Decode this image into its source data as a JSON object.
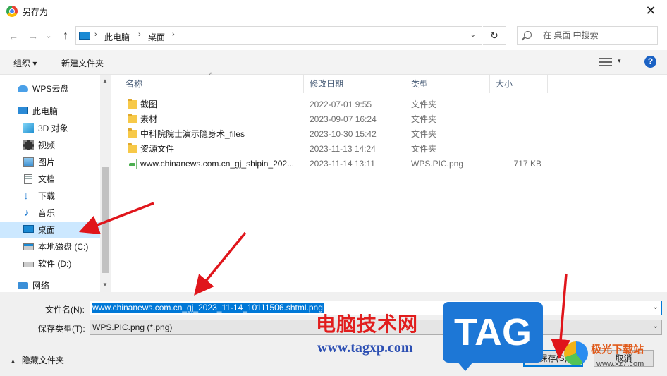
{
  "window": {
    "title": "另存为",
    "close_glyph": "✕"
  },
  "nav": {
    "back": "←",
    "forward": "→",
    "down": "⌄",
    "up": "↑",
    "refresh": "↻",
    "dropdown": "⌄"
  },
  "address": {
    "crumbs": [
      "此电脑",
      "桌面"
    ]
  },
  "search": {
    "placeholder": "在 桌面 中搜索"
  },
  "toolbar": {
    "organize": "组织 ▾",
    "new_folder": "新建文件夹",
    "help": "?",
    "dropdown": "▾"
  },
  "sidebar": {
    "items": [
      {
        "label": "WPS云盘",
        "icon": "cloud-icon"
      },
      {
        "label": "此电脑",
        "icon": "computer-icon"
      },
      {
        "label": "3D 对象",
        "icon": "3d-objects-icon"
      },
      {
        "label": "视频",
        "icon": "video-icon"
      },
      {
        "label": "图片",
        "icon": "pictures-icon"
      },
      {
        "label": "文档",
        "icon": "documents-icon"
      },
      {
        "label": "下载",
        "icon": "download-icon"
      },
      {
        "label": "音乐",
        "icon": "music-icon"
      },
      {
        "label": "桌面",
        "icon": "desktop-icon",
        "selected": true
      },
      {
        "label": "本地磁盘 (C:)",
        "icon": "drive-icon"
      },
      {
        "label": "软件 (D:)",
        "icon": "drive-icon"
      },
      {
        "label": "网络",
        "icon": "network-icon"
      }
    ]
  },
  "columns": {
    "name": "名称",
    "date": "修改日期",
    "type": "类型",
    "size": "大小",
    "sort_glyph": "^"
  },
  "files": [
    {
      "name": "截图",
      "date": "2022-07-01 9:55",
      "type": "文件夹",
      "size": "",
      "icon": "folder-icon"
    },
    {
      "name": "素材",
      "date": "2023-09-07 16:24",
      "type": "文件夹",
      "size": "",
      "icon": "folder-icon"
    },
    {
      "name": "中科院院士演示隐身术_files",
      "date": "2023-10-30 15:42",
      "type": "文件夹",
      "size": "",
      "icon": "folder-icon"
    },
    {
      "name": "资源文件",
      "date": "2023-11-13 14:24",
      "type": "文件夹",
      "size": "",
      "icon": "folder-icon"
    },
    {
      "name": "www.chinanews.com.cn_gj_shipin_202...",
      "date": "2023-11-14 13:11",
      "type": "WPS.PIC.png",
      "size": "717 KB",
      "icon": "png-file-icon"
    }
  ],
  "bottom": {
    "filename_label": "文件名(N):",
    "filename_value": "www.chinanews.com.cn_gj_2023_11-14_10111506.shtml.png",
    "filetype_label": "保存类型(T):",
    "filetype_value": "WPS.PIC.png (*.png)",
    "hide_folders": "隐藏文件夹",
    "hide_glyph": "▲",
    "save": "保存(S)",
    "cancel": "取消",
    "dropdown": "⌄"
  },
  "watermarks": {
    "site_name": "电脑技术网",
    "site_url": "www.tagxp.com",
    "tag": "TAG",
    "jg_name": "极光下载站",
    "jg_url": "www.xz7.com"
  },
  "colors": {
    "accent": "#0078d7",
    "selected_bg": "#cce8ff",
    "arrow": "#e0151b"
  }
}
